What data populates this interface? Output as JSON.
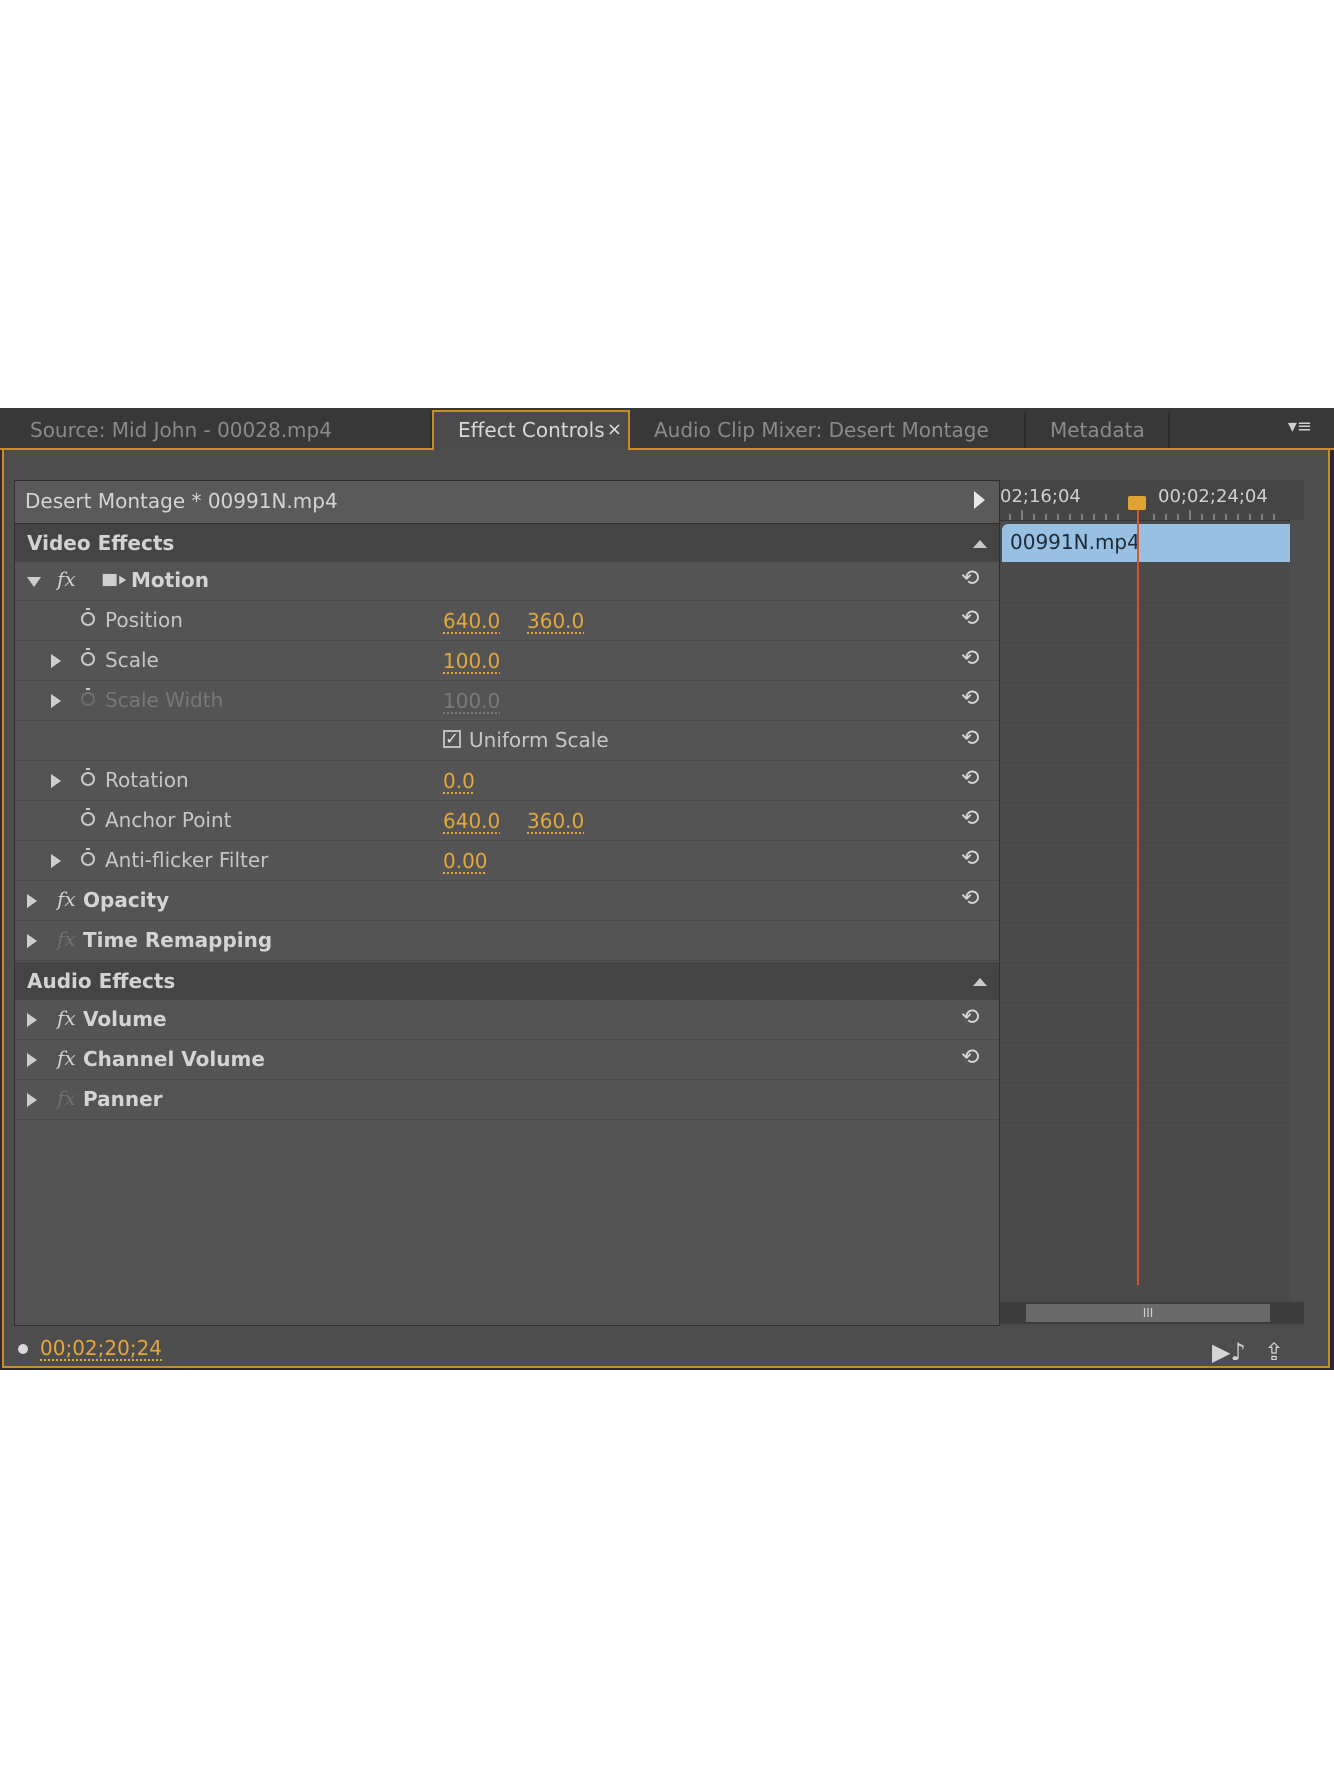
{
  "tabs": [
    {
      "label": "Source: Mid John - 00028.mp4",
      "active": false
    },
    {
      "label": "Effect Controls",
      "active": true
    },
    {
      "label": "Audio Clip Mixer: Desert Montage",
      "active": false
    },
    {
      "label": "Metadata",
      "active": false
    }
  ],
  "tab_close": "×",
  "menu_icon": "≡",
  "clip_header": "Desert Montage * 00991N.mp4",
  "sections": {
    "video": "Video Effects",
    "audio": "Audio Effects"
  },
  "motion": {
    "name": "Motion",
    "position": {
      "label": "Position",
      "x": "640.0",
      "y": "360.0"
    },
    "scale": {
      "label": "Scale",
      "value": "100.0"
    },
    "scale_width": {
      "label": "Scale Width",
      "value": "100.0"
    },
    "uniform_scale": {
      "label": "Uniform Scale",
      "checked": true
    },
    "rotation": {
      "label": "Rotation",
      "value": "0.0"
    },
    "anchor_point": {
      "label": "Anchor Point",
      "x": "640.0",
      "y": "360.0"
    },
    "anti_flicker": {
      "label": "Anti-flicker Filter",
      "value": "0.00"
    }
  },
  "effects": {
    "opacity": "Opacity",
    "time_remapping": "Time Remapping",
    "volume": "Volume",
    "channel_volume": "Channel Volume",
    "panner": "Panner"
  },
  "fx_glyph": "fx",
  "reset_glyph": "⟲",
  "timeline": {
    "tick_left": "02;16;04",
    "tick_right": "00;02;24;04",
    "clip_name": "00991N.mp4",
    "scroll_grip": "III"
  },
  "timecode": "00;02;20;24",
  "colors": {
    "accent": "#e3a73a",
    "panel_border": "#c98a28",
    "clip": "#97c0e2",
    "playhead": "#d9532f"
  }
}
